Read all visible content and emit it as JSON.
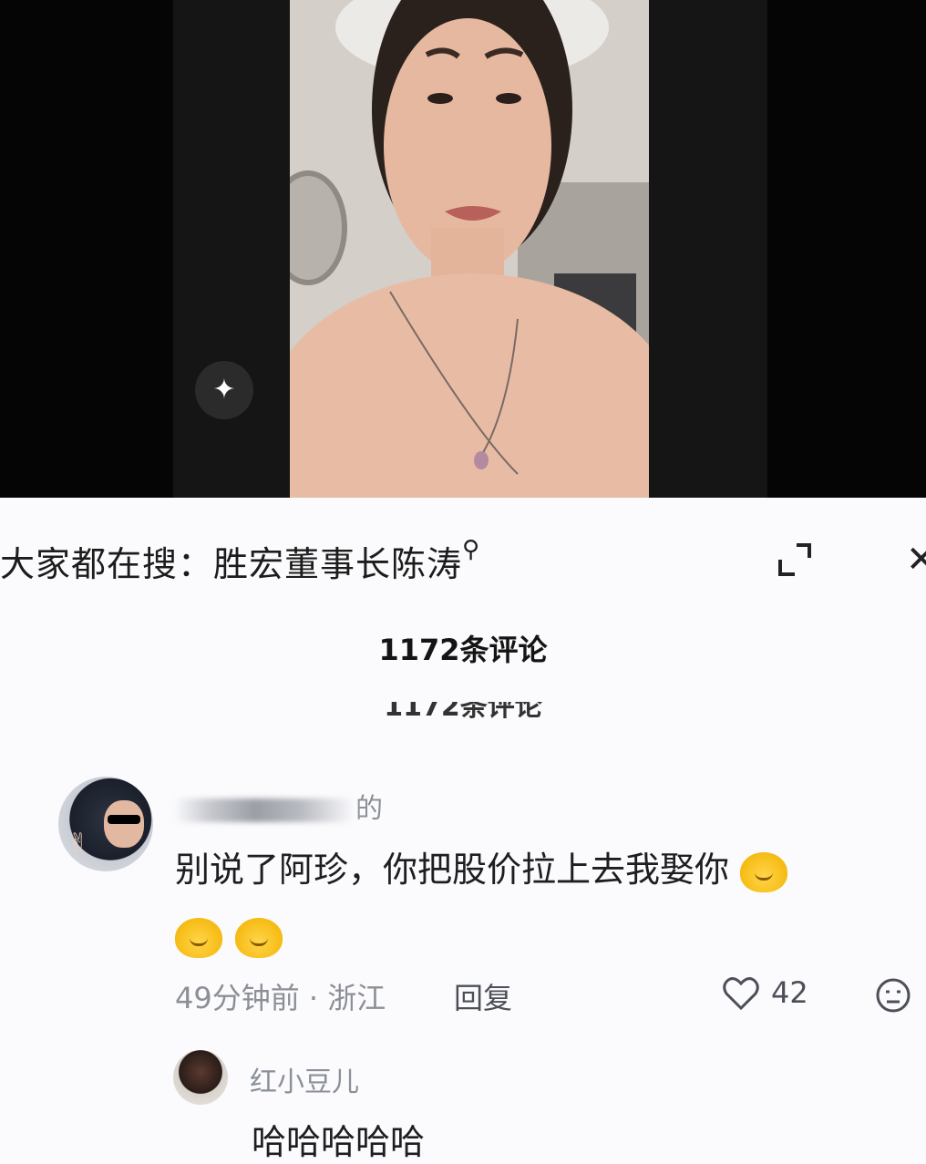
{
  "video": {
    "action_icon": "sparkle-icon"
  },
  "search_hint": {
    "label": "大家都在搜：",
    "query": "胜宏董事长陈涛",
    "icon": "search-icon"
  },
  "comments_header": {
    "count_label": "1172条评论",
    "ghost_label": "1172条评论"
  },
  "comment": {
    "username_suffix": "的",
    "text": "别说了阿珍，你把股价拉上去我娶你",
    "emojis": [
      "crying-face",
      "crying-face",
      "crying-face"
    ],
    "time": "49分钟前",
    "separator": "·",
    "location": "浙江",
    "reply_label": "回复",
    "like_count": "42"
  },
  "reply": {
    "username": "红小豆儿",
    "text": "哈哈哈哈哈"
  },
  "colors": {
    "accent_emoji": "#f5b90f",
    "text_primary": "#1e1e22",
    "text_secondary": "#8c8f97"
  }
}
